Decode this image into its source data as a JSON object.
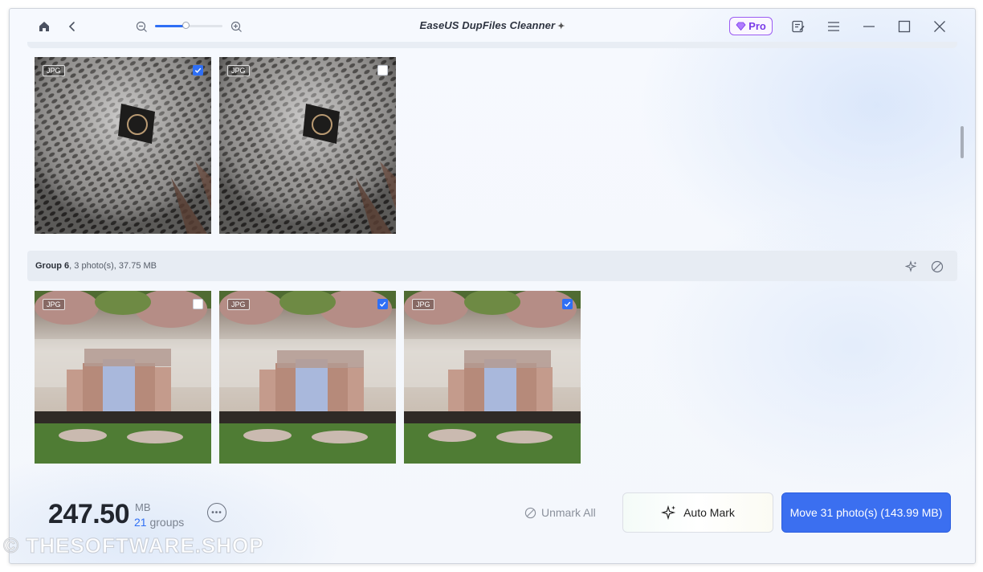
{
  "window": {
    "title": "EaseUS DupFiles Cleanner",
    "title_sparkle": "✦",
    "pro_label": "Pro"
  },
  "toolbar": {
    "zoom_level": 0.45
  },
  "groups": [
    {
      "photos": [
        {
          "tag": "JPG",
          "checked": true
        },
        {
          "tag": "JPG",
          "checked": false
        }
      ]
    },
    {
      "name": "Group 6",
      "summary": ", 3 photo(s), 37.75 MB",
      "photos": [
        {
          "tag": "JPG",
          "checked": false
        },
        {
          "tag": "JPG",
          "checked": true
        },
        {
          "tag": "JPG",
          "checked": true
        }
      ]
    }
  ],
  "footer": {
    "size_value": "247.50",
    "size_unit": "MB",
    "groups_count": "21",
    "groups_label": "groups",
    "unmark_all_label": "Unmark All",
    "auto_mark_label": "Auto Mark",
    "move_label": "Move 31 photo(s) (143.99 MB)"
  },
  "watermark": "© THESOFTWARE.SHOP",
  "colors": {
    "accent": "#2f6ff5",
    "move_button": "#3b6ff0",
    "pro": "#7a3be8"
  }
}
